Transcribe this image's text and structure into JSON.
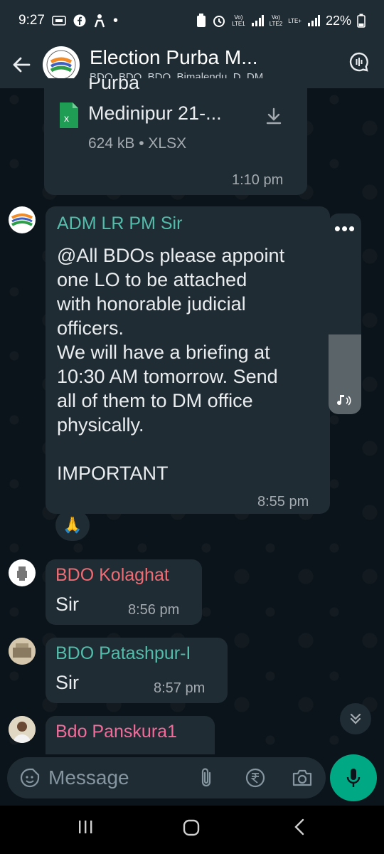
{
  "status": {
    "time": "9:27",
    "net1_top": "Vo)",
    "net1_bottom": "LTE1",
    "net2_top": "Vo)",
    "net2_bottom": "LTE2",
    "lte_plus": "LTE+",
    "battery": "22%"
  },
  "header": {
    "title": "Election Purba M...",
    "subtitle": "BDO, BDO, BDO, Bimalendu, D, DM..."
  },
  "file_message": {
    "top_cut_text": "Purba",
    "file_name": "Medinipur 21-...",
    "file_meta": "624 kB • XLSX",
    "time": "1:10 pm"
  },
  "message_adm": {
    "sender": "ADM LR PM Sir",
    "lines": [
      "@All BDOs please appoint",
      "one LO to be attached",
      "with honorable judicial",
      "officers.",
      "We will have a briefing at",
      "10:30 AM tomorrow. Send",
      "all of them to DM office",
      "physically.",
      "",
      "IMPORTANT"
    ],
    "time": "8:55 pm",
    "reaction": "🙏"
  },
  "message_kolaghat": {
    "sender": "BDO Kolaghat",
    "text": "Sir",
    "time": "8:56 pm"
  },
  "message_patashpur": {
    "sender": "BDO Patashpur-I",
    "text": "Sir",
    "time": "8:57 pm"
  },
  "message_panskura": {
    "sender": "Bdo Panskura1"
  },
  "input": {
    "placeholder": "Message"
  },
  "colors": {
    "adm_name": "#53bdac",
    "kolaghat_name": "#f06c74",
    "patashpur_name": "#53bdac",
    "panskura_name": "#f06c9a",
    "accent_green": "#00a884",
    "excel_green": "#1f9d55"
  }
}
